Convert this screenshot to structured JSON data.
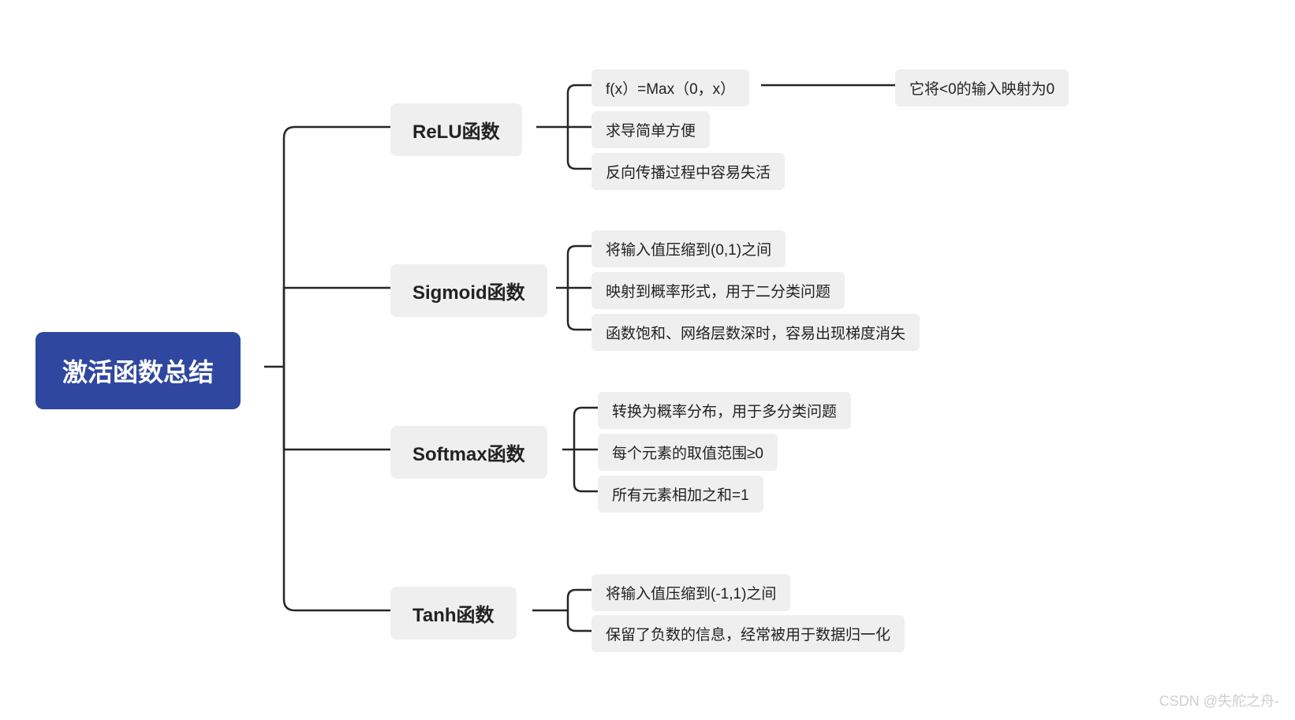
{
  "mindmap": {
    "root": "激活函数总结",
    "branches": [
      {
        "label": "ReLU函数",
        "children": [
          {
            "label": "f(x）=Max（0，x）",
            "children": [
              {
                "label": "它将<0的输入映射为0"
              }
            ]
          },
          {
            "label": "求导简单方便"
          },
          {
            "label": "反向传播过程中容易失活"
          }
        ]
      },
      {
        "label": "Sigmoid函数",
        "children": [
          {
            "label": "将输入值压缩到(0,1)之间"
          },
          {
            "label": "映射到概率形式，用于二分类问题"
          },
          {
            "label": "函数饱和、网络层数深时，容易出现梯度消失"
          }
        ]
      },
      {
        "label": "Softmax函数",
        "children": [
          {
            "label": "转换为概率分布，用于多分类问题"
          },
          {
            "label": "每个元素的取值范围≥0"
          },
          {
            "label": "所有元素相加之和=1"
          }
        ]
      },
      {
        "label": "Tanh函数",
        "children": [
          {
            "label": "将输入值压缩到(-1,1)之间"
          },
          {
            "label": "保留了负数的信息，经常被用于数据归一化"
          }
        ]
      }
    ]
  },
  "watermark": "CSDN @失舵之舟-"
}
